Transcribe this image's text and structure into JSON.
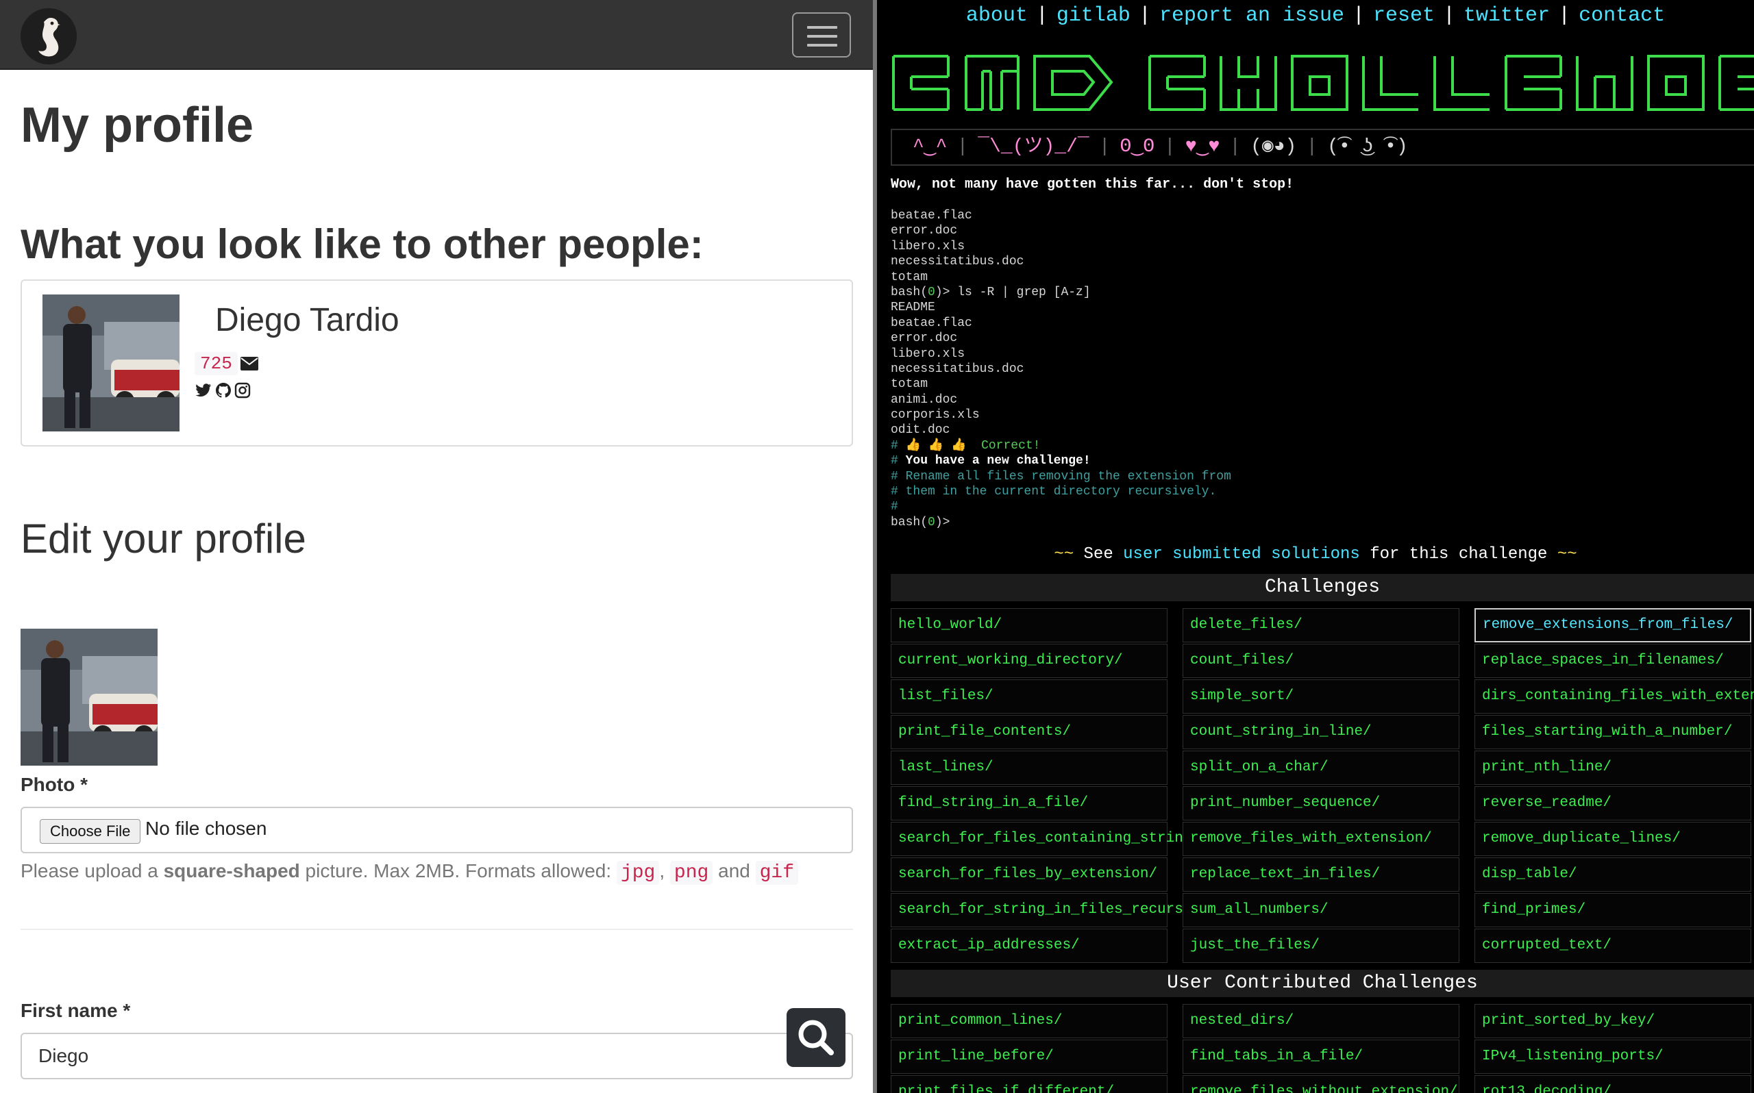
{
  "left": {
    "page_title": "My profile",
    "public_heading": "What you look like to other people:",
    "profile": {
      "name": "Diego Tardio",
      "score": "725"
    },
    "edit_heading": "Edit your profile",
    "photo_label": "Photo *",
    "file_button": "Choose File",
    "file_status": "No file chosen",
    "help": {
      "part1": "Please upload a ",
      "bold": "square-shaped",
      "part2": " picture. Max 2MB. Formats allowed: ",
      "fmt1": "jpg",
      "comma": ", ",
      "fmt2": "png",
      "and": " and ",
      "fmt3": "gif"
    },
    "first_name_label": "First name *",
    "first_name_value": "Diego"
  },
  "right": {
    "nav": [
      "about",
      "gitlab",
      "report an issue",
      "reset",
      "twitter",
      "contact"
    ],
    "emoticons": [
      "^‿^",
      "¯\\_(ツ)_/¯",
      "ʘ‿ʘ",
      "♥‿♥",
      "(◉◕)",
      "(͡• ͜ʖ ͡•)"
    ],
    "subtitle": "Wow, not many have gotten this far... don't stop!",
    "terminal": [
      {
        "t": "beatae.flac",
        "s": ""
      },
      {
        "t": "error.doc",
        "s": ""
      },
      {
        "t": "libero.xls",
        "s": ""
      },
      {
        "t": "necessitatibus.doc",
        "s": ""
      },
      {
        "t": "totam",
        "s": ""
      },
      {
        "t": "bash(0)> ls -R | grep [A-z]",
        "s": "prompt"
      },
      {
        "t": "README",
        "s": ""
      },
      {
        "t": "beatae.flac",
        "s": ""
      },
      {
        "t": "error.doc",
        "s": ""
      },
      {
        "t": "libero.xls",
        "s": ""
      },
      {
        "t": "necessitatibus.doc",
        "s": ""
      },
      {
        "t": "totam",
        "s": ""
      },
      {
        "t": "animi.doc",
        "s": ""
      },
      {
        "t": "corporis.xls",
        "s": ""
      },
      {
        "t": "odit.doc",
        "s": ""
      },
      {
        "t": "# 👍 👍 👍  Correct!",
        "s": "correct"
      },
      {
        "t": "# You have a new challenge!",
        "s": "new"
      },
      {
        "t": "# Rename all files removing the extension from",
        "s": "comment"
      },
      {
        "t": "# them in the current directory recursively.",
        "s": "comment"
      },
      {
        "t": "#",
        "s": "comment"
      },
      {
        "t": "bash(0)>",
        "s": "prompt"
      }
    ],
    "see": {
      "pre": "See ",
      "link": "user submitted solutions",
      "post": " for this challenge",
      "deco": "~~"
    },
    "challenges_heading": "Challenges",
    "challenges": [
      [
        "hello_world/",
        "delete_files/",
        "remove_extensions_from_files/"
      ],
      [
        "current_working_directory/",
        "count_files/",
        "replace_spaces_in_filenames/"
      ],
      [
        "list_files/",
        "simple_sort/",
        "dirs_containing_files_with_extension/"
      ],
      [
        "print_file_contents/",
        "count_string_in_line/",
        "files_starting_with_a_number/"
      ],
      [
        "last_lines/",
        "split_on_a_char/",
        "print_nth_line/"
      ],
      [
        "find_string_in_a_file/",
        "print_number_sequence/",
        "reverse_readme/"
      ],
      [
        "search_for_files_containing_string/",
        "remove_files_with_extension/",
        "remove_duplicate_lines/"
      ],
      [
        "search_for_files_by_extension/",
        "replace_text_in_files/",
        "disp_table/"
      ],
      [
        "search_for_string_in_files_recursive/",
        "sum_all_numbers/",
        "find_primes/"
      ],
      [
        "extract_ip_addresses/",
        "just_the_files/",
        "corrupted_text/"
      ]
    ],
    "active_challenge": "remove_extensions_from_files/",
    "user_heading": "User Contributed Challenges",
    "user_challenges": [
      [
        "print_common_lines/",
        "nested_dirs/",
        "print_sorted_by_key/"
      ],
      [
        "print_line_before/",
        "find_tabs_in_a_file/",
        "IPv4_listening_ports/"
      ],
      [
        "print_files_if_different/",
        "remove_files_without_extension/",
        "rot13_decoding/"
      ]
    ]
  }
}
